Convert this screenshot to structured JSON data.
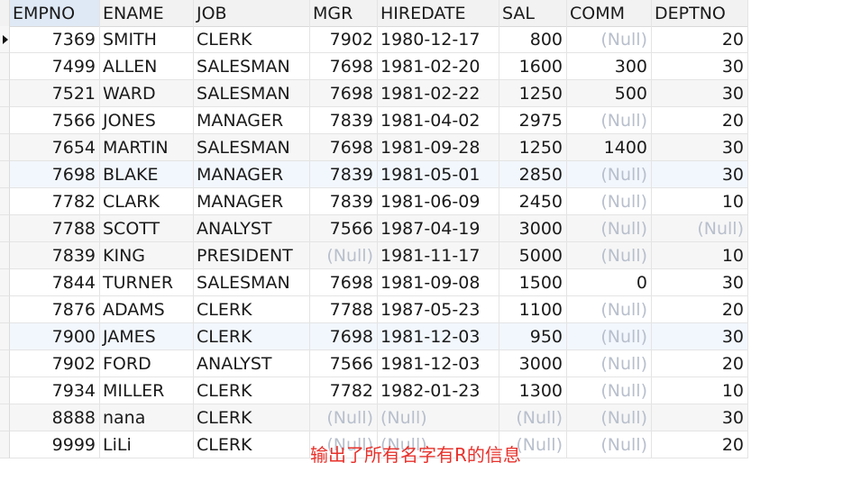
{
  "columns": [
    "EMPNO",
    "ENAME",
    "JOB",
    "MGR",
    "HIREDATE",
    "SAL",
    "COMM",
    "DEPTNO"
  ],
  "rows": [
    [
      "7369",
      "SMITH",
      "CLERK",
      "7902",
      "1980-12-17",
      "800",
      "(Null)",
      "20"
    ],
    [
      "7499",
      "ALLEN",
      "SALESMAN",
      "7698",
      "1981-02-20",
      "1600",
      "300",
      "30"
    ],
    [
      "7521",
      "WARD",
      "SALESMAN",
      "7698",
      "1981-02-22",
      "1250",
      "500",
      "30"
    ],
    [
      "7566",
      "JONES",
      "MANAGER",
      "7839",
      "1981-04-02",
      "2975",
      "(Null)",
      "20"
    ],
    [
      "7654",
      "MARTIN",
      "SALESMAN",
      "7698",
      "1981-09-28",
      "1250",
      "1400",
      "30"
    ],
    [
      "7698",
      "BLAKE",
      "MANAGER",
      "7839",
      "1981-05-01",
      "2850",
      "(Null)",
      "30"
    ],
    [
      "7782",
      "CLARK",
      "MANAGER",
      "7839",
      "1981-06-09",
      "2450",
      "(Null)",
      "10"
    ],
    [
      "7788",
      "SCOTT",
      "ANALYST",
      "7566",
      "1987-04-19",
      "3000",
      "(Null)",
      "(Null)"
    ],
    [
      "7839",
      "KING",
      "PRESIDENT",
      "(Null)",
      "1981-11-17",
      "5000",
      "(Null)",
      "10"
    ],
    [
      "7844",
      "TURNER",
      "SALESMAN",
      "7698",
      "1981-09-08",
      "1500",
      "0",
      "30"
    ],
    [
      "7876",
      "ADAMS",
      "CLERK",
      "7788",
      "1987-05-23",
      "1100",
      "(Null)",
      "20"
    ],
    [
      "7900",
      "JAMES",
      "CLERK",
      "7698",
      "1981-12-03",
      "950",
      "(Null)",
      "30"
    ],
    [
      "7902",
      "FORD",
      "ANALYST",
      "7566",
      "1981-12-03",
      "3000",
      "(Null)",
      "20"
    ],
    [
      "7934",
      "MILLER",
      "CLERK",
      "7782",
      "1982-01-23",
      "1300",
      "(Null)",
      "10"
    ],
    [
      "8888",
      "nana",
      "CLERK",
      "(Null)",
      "(Null)",
      "(Null)",
      "(Null)",
      "30"
    ],
    [
      "9999",
      "LiLi",
      "CLERK",
      "(Null)",
      "(Null)",
      "(Null)",
      "(Null)",
      "20"
    ]
  ],
  "annotation": "输出了所有名字有R的信息",
  "colors": {
    "annotation": "#e8312b",
    "null_text": "#b8bfcc",
    "header_bg": "#f2f2f2",
    "selected_header_bg": "#dfe9f5"
  }
}
